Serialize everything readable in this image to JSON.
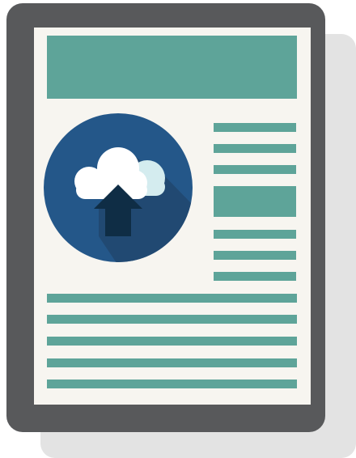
{
  "colors": {
    "frame": "#58595b",
    "paper": "#f7f5f0",
    "accent": "#5ea499",
    "circle": "#245789",
    "circle_shadow": "#214870",
    "cloud_front": "#ffffff",
    "cloud_back": "#d4ecef",
    "arrow": "#0f2d45",
    "backdrop_shadow": "#e3e3e3"
  },
  "icon": "cloud-upload-icon",
  "illustration": "document-with-cloud-upload"
}
